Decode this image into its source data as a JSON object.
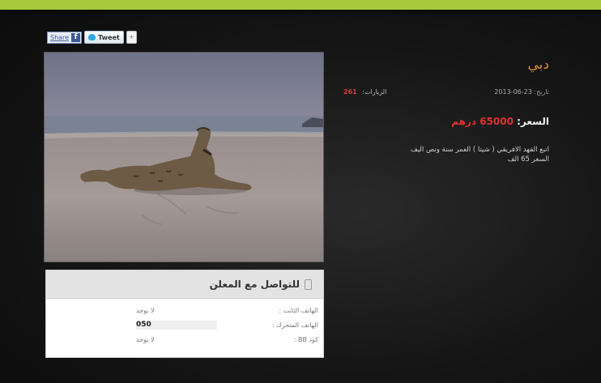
{
  "share": {
    "share_label": "Share",
    "fb_label": "f",
    "tweet_label": "Tweet",
    "plus_label": "+"
  },
  "listing": {
    "title": "دبي",
    "date_label": "تاريخ:",
    "date": "23-06-2013",
    "visits_label": "الزيارات:",
    "visits": "261",
    "price_label": "السعر:",
    "price": "65000 درهم",
    "description": "اتبع الفهد الافريقي ( شيتا ) العمر سنة ونص اليف السعر 65 الف"
  },
  "contact": {
    "title": "للتواصل مع المعلن",
    "rows": [
      {
        "label": "الهاتف الثابت :",
        "value": "لا يوجد"
      },
      {
        "label": "الهاتف المتحرك :",
        "value": "050"
      },
      {
        "label": "كود BB :",
        "value": "لا يوجد"
      }
    ]
  },
  "colors": {
    "accent_bar": "#a7c93c",
    "title": "#d8902e",
    "price": "#e0322e"
  }
}
